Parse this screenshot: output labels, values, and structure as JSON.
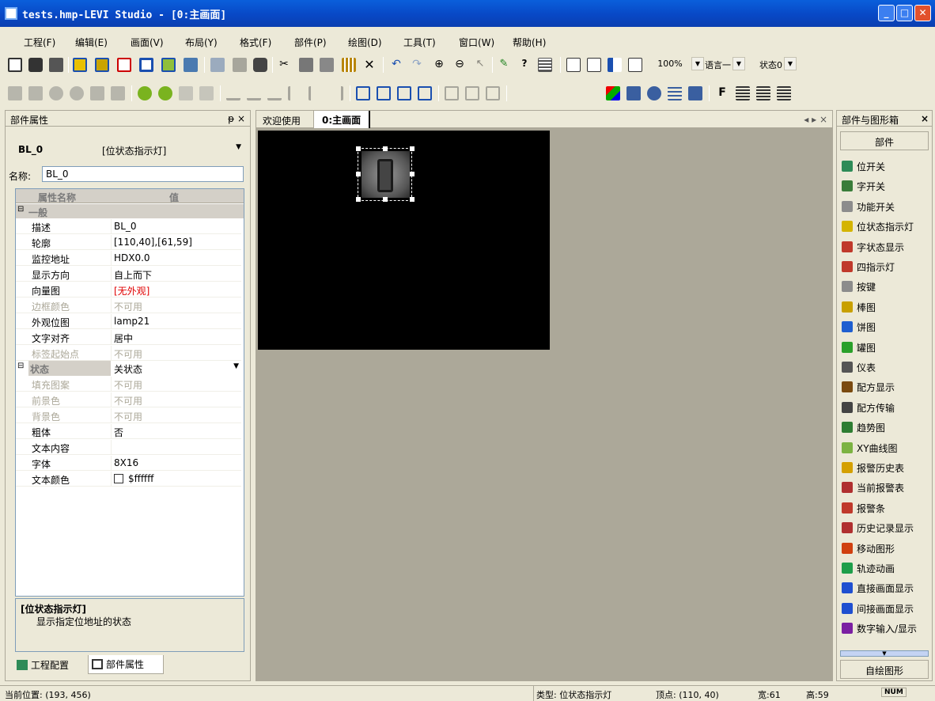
{
  "window": {
    "title": "tests.hmp-LEVI Studio - [0:主画面]"
  },
  "menu": [
    "工程(F)",
    "编辑(E)",
    "画面(V)",
    "布局(Y)",
    "格式(F)",
    "部件(P)",
    "绘图(D)",
    "工具(T)",
    "窗口(W)",
    "帮助(H)"
  ],
  "toolbar": {
    "zoom": "100%",
    "language": "语言一",
    "state": "状态0"
  },
  "left_panel": {
    "title": "部件属性",
    "pin": "ᵽ ×",
    "component_name": "BL_0",
    "component_type": "[位状态指示灯]",
    "name_label": "名称:",
    "name_value": "BL_0",
    "header_name": "属性名称",
    "header_value": "值",
    "group_general": "一般",
    "rows_general": [
      {
        "name": "描述",
        "value": "BL_0",
        "disabled": false
      },
      {
        "name": "轮廓",
        "value": "[110,40],[61,59]",
        "disabled": false
      },
      {
        "name": "监控地址",
        "value": "HDX0.0",
        "disabled": false
      },
      {
        "name": "显示方向",
        "value": "自上而下",
        "disabled": false
      },
      {
        "name": "向量图",
        "value": "[无外观]",
        "disabled": false,
        "red": true
      },
      {
        "name": "边框颜色",
        "value": "不可用",
        "disabled": true
      },
      {
        "name": "外观位图",
        "value": "lamp21",
        "disabled": false
      },
      {
        "name": "文字对齐",
        "value": "居中",
        "disabled": false
      },
      {
        "name": "标签起始点",
        "value": "不可用",
        "disabled": true
      }
    ],
    "group_state": "状态",
    "state_value": "关状态",
    "rows_state": [
      {
        "name": "填充图案",
        "value": "不可用",
        "disabled": true
      },
      {
        "name": "前景色",
        "value": "不可用",
        "disabled": true
      },
      {
        "name": "背景色",
        "value": "不可用",
        "disabled": true
      },
      {
        "name": "粗体",
        "value": "否",
        "disabled": false
      },
      {
        "name": "文本内容",
        "value": "",
        "disabled": false
      },
      {
        "name": "字体",
        "value": "8X16",
        "disabled": false
      },
      {
        "name": "文本颜色",
        "value": "$ffffff",
        "disabled": false,
        "swatch": true
      }
    ],
    "desc_title": "[位状态指示灯]",
    "desc_text": "显示指定位地址的状态",
    "tab_project": "工程配置",
    "tab_props": "部件属性"
  },
  "editor": {
    "tab_welcome": "欢迎使用",
    "tab_main": "0:主画面",
    "nav": "◂ ▸ ×"
  },
  "right_panel": {
    "title": "部件与图形箱",
    "section": "部件",
    "bottom_button": "自绘图形",
    "items": [
      {
        "label": "位开关",
        "color": "#2e8b57"
      },
      {
        "label": "字开关",
        "color": "#3a7d3a"
      },
      {
        "label": "功能开关",
        "color": "#8c8c8c"
      },
      {
        "label": "位状态指示灯",
        "color": "#d4b400"
      },
      {
        "label": "字状态显示",
        "color": "#c0392b"
      },
      {
        "label": "四指示灯",
        "color": "#c0392b"
      },
      {
        "label": "按键",
        "color": "#8c8c8c"
      },
      {
        "label": "棒图",
        "color": "#c8a000"
      },
      {
        "label": "饼图",
        "color": "#1f5fd0"
      },
      {
        "label": "罐图",
        "color": "#2aa02a"
      },
      {
        "label": "仪表",
        "color": "#555555"
      },
      {
        "label": "配方显示",
        "color": "#7a4a10"
      },
      {
        "label": "配方传输",
        "color": "#444444"
      },
      {
        "label": "趋势图",
        "color": "#2e7d32"
      },
      {
        "label": "XY曲线图",
        "color": "#7cb342"
      },
      {
        "label": "报警历史表",
        "color": "#d4a000"
      },
      {
        "label": "当前报警表",
        "color": "#b03030"
      },
      {
        "label": "报警条",
        "color": "#c0392b"
      },
      {
        "label": "历史记录显示",
        "color": "#b03030"
      },
      {
        "label": "移动图形",
        "color": "#d04010"
      },
      {
        "label": "轨迹动画",
        "color": "#1e9e4a"
      },
      {
        "label": "直接画面显示",
        "color": "#1f4fd0"
      },
      {
        "label": "间接画面显示",
        "color": "#1f4fd0"
      },
      {
        "label": "数字输入/显示",
        "color": "#7b1fa2"
      }
    ]
  },
  "status": {
    "position": "当前位置: (193, 456)",
    "type": "类型: 位状态指示灯",
    "vertex": "顶点: (110, 40)",
    "width": "宽:61",
    "height": "高:59",
    "num": "NUM"
  }
}
